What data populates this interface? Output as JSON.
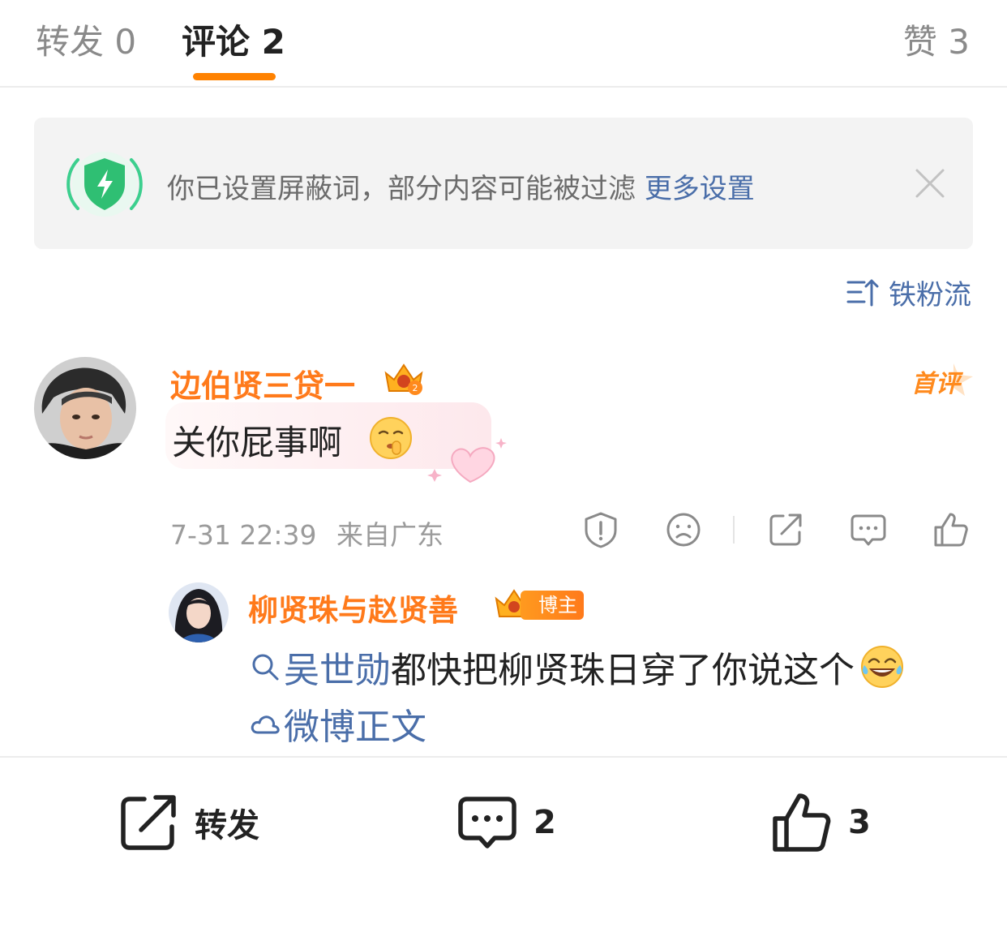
{
  "tabs": {
    "repost": "转发 0",
    "comment": "评论 2",
    "like": "赞 3",
    "active": "comment",
    "accent_color": "#ff8200"
  },
  "notice": {
    "text": "你已设置屏蔽词，部分内容可能被过滤",
    "link": "更多设置",
    "icon": "shield-bolt-icon",
    "close_icon": "close-icon"
  },
  "sort": {
    "label": "铁粉流",
    "icon": "sort-icon"
  },
  "comment": {
    "username": "边伯贤三贷一",
    "badge_icon": "crown-badge-icon",
    "first_comment_badge": "首评",
    "text": "关你屁事啊",
    "emoji": "shush-emoji",
    "timestamp": "7-31 22:39",
    "location": "来自广东",
    "actions": [
      "report-icon",
      "dislike-icon",
      "share-icon",
      "reply-icon",
      "like-icon"
    ]
  },
  "reply": {
    "username": "柳贤珠与赵贤善",
    "badge_icon": "crown-badge-icon",
    "host_badge": "博主",
    "search_link": "吴世勋",
    "text": "都快把柳贤珠日穿了你说这个",
    "emoji": "laugh-cry-emoji",
    "weibo_link": "微博正文"
  },
  "bottom_bar": {
    "repost_label": "转发",
    "comment_count": "2",
    "like_count": "3"
  },
  "colors": {
    "username": "#ff7a1b",
    "link": "#4a6ea9",
    "meta": "#9b9b9b"
  }
}
